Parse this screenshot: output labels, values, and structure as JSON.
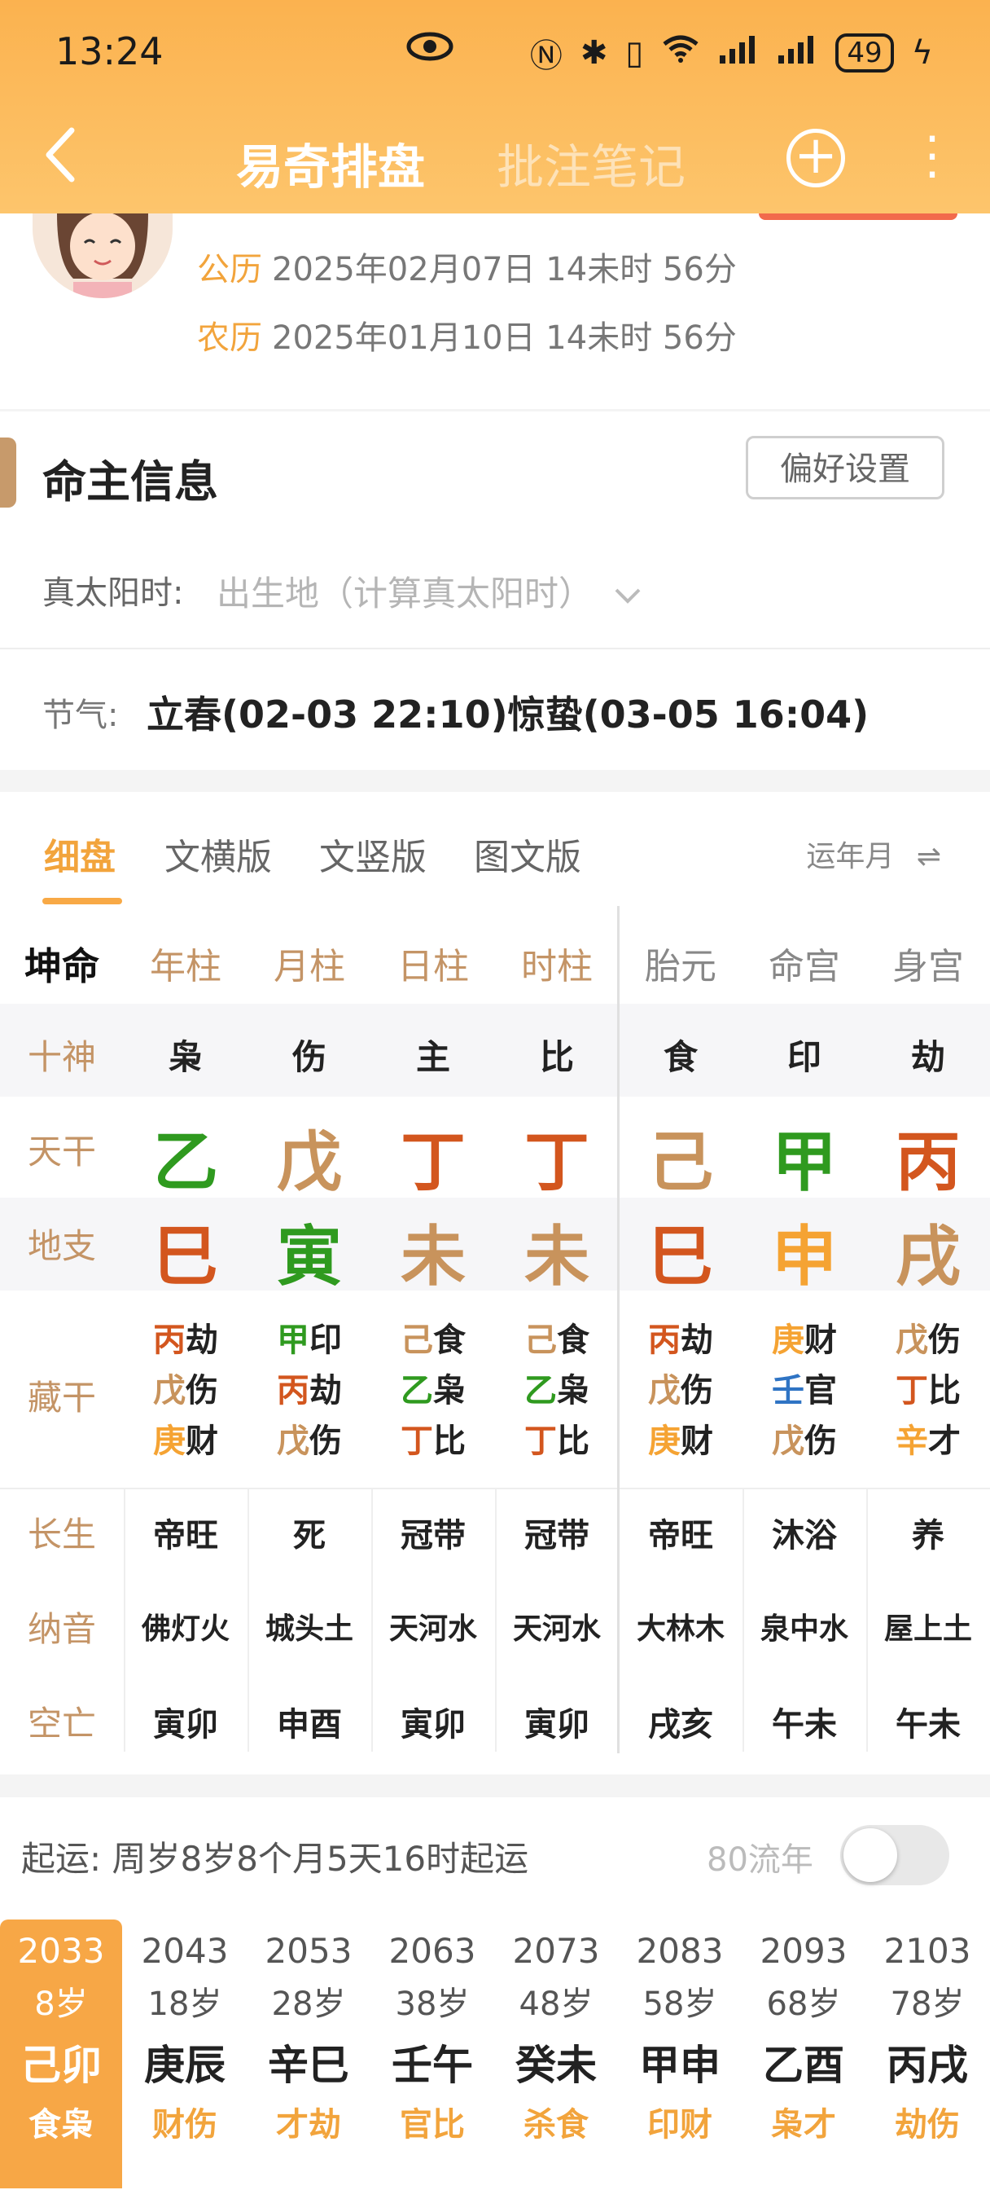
{
  "status_bar": {
    "time": "13:24",
    "battery": "49"
  },
  "nav": {
    "title_active": "易奇排盘",
    "title_inactive": "批注笔记"
  },
  "profile": {
    "solar_label": "公历",
    "solar_value": "2025年02月07日 14未时 56分",
    "lunar_label": "农历",
    "lunar_value": "2025年01月10日 14未时 56分"
  },
  "info": {
    "title": "命主信息",
    "pref_button": "偏好设置",
    "solar_time_label": "真太阳时:",
    "solar_time_value": "出生地（计算真太阳时）",
    "jieqi_label": "节气:",
    "jieqi_value": "立春(02-03 22:10)惊蛰(03-05 16:04)"
  },
  "chart": {
    "tabs": [
      "细盘",
      "文横版",
      "文竖版",
      "图文版"
    ],
    "right_label": "运年月",
    "corner": "坤命",
    "columns": [
      "年柱",
      "月柱",
      "日柱",
      "时柱",
      "胎元",
      "命宫",
      "身宫"
    ],
    "row_labels": {
      "shishen": "十神",
      "tiangan": "天干",
      "dizhi": "地支",
      "canggan": "藏干",
      "changsheng": "长生",
      "nayin": "纳音",
      "kongwang": "空亡"
    },
    "shishen": [
      "枭",
      "伤",
      "主",
      "比",
      "食",
      "印",
      "劫"
    ],
    "tiangan": [
      "乙",
      "戊",
      "丁",
      "丁",
      "己",
      "甲",
      "丙"
    ],
    "tiangan_colors": [
      "#2f9a1f",
      "#c8935c",
      "#d3561e",
      "#d3561e",
      "#c8935c",
      "#2f9a1f",
      "#d3561e"
    ],
    "dizhi": [
      "巳",
      "寅",
      "未",
      "未",
      "巳",
      "申",
      "戌"
    ],
    "dizhi_colors": [
      "#d3561e",
      "#2f9a1f",
      "#c8935c",
      "#c8935c",
      "#d3561e",
      "#f5a333",
      "#c8935c"
    ],
    "canggan": [
      [
        {
          "g": "丙",
          "s": "劫",
          "c": "#d3561e"
        },
        {
          "g": "戊",
          "s": "伤",
          "c": "#c8935c"
        },
        {
          "g": "庚",
          "s": "财",
          "c": "#f5a333"
        }
      ],
      [
        {
          "g": "甲",
          "s": "印",
          "c": "#2f9a1f"
        },
        {
          "g": "丙",
          "s": "劫",
          "c": "#d3561e"
        },
        {
          "g": "戊",
          "s": "伤",
          "c": "#c8935c"
        }
      ],
      [
        {
          "g": "己",
          "s": "食",
          "c": "#c8935c"
        },
        {
          "g": "乙",
          "s": "枭",
          "c": "#2f9a1f"
        },
        {
          "g": "丁",
          "s": "比",
          "c": "#d3561e"
        }
      ],
      [
        {
          "g": "己",
          "s": "食",
          "c": "#c8935c"
        },
        {
          "g": "乙",
          "s": "枭",
          "c": "#2f9a1f"
        },
        {
          "g": "丁",
          "s": "比",
          "c": "#d3561e"
        }
      ],
      [
        {
          "g": "丙",
          "s": "劫",
          "c": "#d3561e"
        },
        {
          "g": "戊",
          "s": "伤",
          "c": "#c8935c"
        },
        {
          "g": "庚",
          "s": "财",
          "c": "#f5a333"
        }
      ],
      [
        {
          "g": "庚",
          "s": "财",
          "c": "#f5a333"
        },
        {
          "g": "壬",
          "s": "官",
          "c": "#2f74c4"
        },
        {
          "g": "戊",
          "s": "伤",
          "c": "#c8935c"
        }
      ],
      [
        {
          "g": "戊",
          "s": "伤",
          "c": "#c8935c"
        },
        {
          "g": "丁",
          "s": "比",
          "c": "#d3561e"
        },
        {
          "g": "辛",
          "s": "才",
          "c": "#f5a333"
        }
      ]
    ],
    "changsheng": [
      "帝旺",
      "死",
      "冠带",
      "冠带",
      "帝旺",
      "沐浴",
      "养"
    ],
    "nayin": [
      "佛灯火",
      "城头土",
      "天河水",
      "天河水",
      "大林木",
      "泉中水",
      "屋上土"
    ],
    "kongwang": [
      "寅卯",
      "申酉",
      "寅卯",
      "寅卯",
      "戌亥",
      "午未",
      "午未"
    ]
  },
  "qiyun": {
    "text": "起运:  周岁8岁8个月5天16时起运",
    "toggle_label": "80流年",
    "dayun": [
      {
        "year": "2033",
        "age": "8岁",
        "gz": "己卯",
        "ss": "食枭"
      },
      {
        "year": "2043",
        "age": "18岁",
        "gz": "庚辰",
        "ss": "财伤"
      },
      {
        "year": "2053",
        "age": "28岁",
        "gz": "辛巳",
        "ss": "才劫"
      },
      {
        "year": "2063",
        "age": "38岁",
        "gz": "壬午",
        "ss": "官比"
      },
      {
        "year": "2073",
        "age": "48岁",
        "gz": "癸未",
        "ss": "杀食"
      },
      {
        "year": "2083",
        "age": "58岁",
        "gz": "甲申",
        "ss": "印财"
      },
      {
        "year": "2093",
        "age": "68岁",
        "gz": "乙酉",
        "ss": "枭才"
      },
      {
        "year": "2103",
        "age": "78岁",
        "gz": "丙戌",
        "ss": "劫伤"
      }
    ]
  }
}
